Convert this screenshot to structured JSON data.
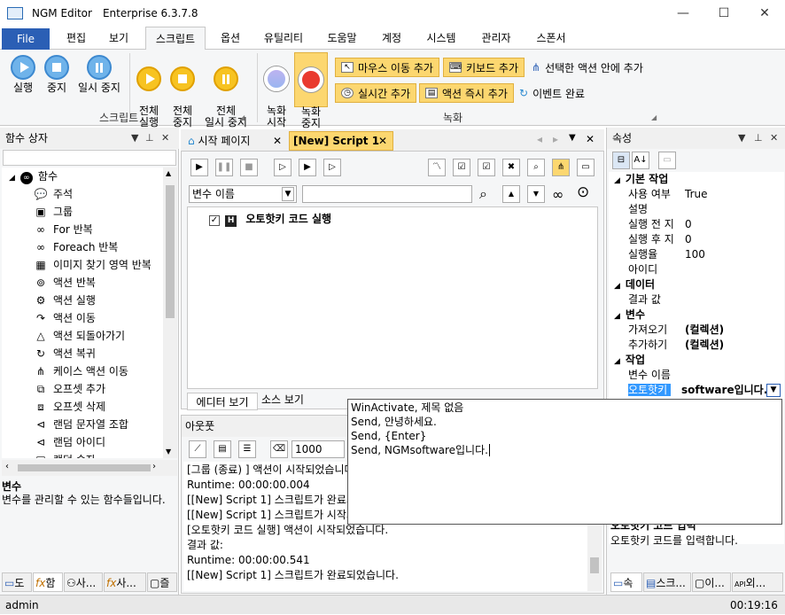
{
  "window": {
    "app_name": "NGM Editor",
    "edition": "Enterprise 6.3.7.8",
    "minimize": "—",
    "maximize": "☐",
    "close": "✕"
  },
  "menu": {
    "file": "File",
    "items": [
      "편집",
      "보기",
      "스크립트",
      "옵션",
      "유틸리티",
      "도움말",
      "계정",
      "시스템",
      "관리자",
      "스폰서"
    ]
  },
  "ribbon": {
    "script_group": "스크립트",
    "record_group": "녹화",
    "run": "실행",
    "stop": "중지",
    "pause": "일시 중지",
    "run_all": "전체\n실행",
    "stop_all": "전체\n중지",
    "pause_all": "전체\n일시 중지",
    "rec_start": "녹화\n시작",
    "rec_stop": "녹화\n중지",
    "add_mouse": "마우스 이동 추가",
    "add_keyboard": "키보드 추가",
    "add_in_selected": "선택한 액션 안에 추가",
    "add_realtime": "실시간 추가",
    "add_instant": "액션 즉시 추가",
    "event_done": "이벤트 완료"
  },
  "left_panel": {
    "title": "함수 상자",
    "root": "함수",
    "items": [
      {
        "label": "주석",
        "icon": "comment-icon",
        "glyph": "💬"
      },
      {
        "label": "그룹",
        "icon": "group-icon",
        "glyph": "▣"
      },
      {
        "label": "For 반복",
        "icon": "loop-icon",
        "glyph": "∞"
      },
      {
        "label": "Foreach 반복",
        "icon": "foreach-icon",
        "glyph": "∞"
      },
      {
        "label": "이미지 찾기 영역 반복",
        "icon": "image-search-icon",
        "glyph": "▦"
      },
      {
        "label": "액션 반복",
        "icon": "repeat-icon",
        "glyph": "⊚"
      },
      {
        "label": "액션 실행",
        "icon": "action-run-icon",
        "glyph": "⚙"
      },
      {
        "label": "액션 이동",
        "icon": "action-move-icon",
        "glyph": "↷"
      },
      {
        "label": "액션 되돌아가기",
        "icon": "action-back-icon",
        "glyph": "△"
      },
      {
        "label": "액션 복귀",
        "icon": "action-return-icon",
        "glyph": "↻"
      },
      {
        "label": "케이스 액션 이동",
        "icon": "case-move-icon",
        "glyph": "⋔"
      },
      {
        "label": "오프셋 추가",
        "icon": "offset-add-icon",
        "glyph": "⧉"
      },
      {
        "label": "오프셋 삭제",
        "icon": "offset-delete-icon",
        "glyph": "⧈"
      },
      {
        "label": "랜덤 문자열 조합",
        "icon": "random-string-icon",
        "glyph": "⊲"
      },
      {
        "label": "랜덤 아이디",
        "icon": "random-id-icon",
        "glyph": "⊲"
      },
      {
        "label": "랜덤 숫자",
        "icon": "random-number-icon",
        "glyph": "▣"
      }
    ],
    "desc_title": "변수",
    "desc_text": "변수를 관리할 수 있는 함수들입니다.",
    "bottom_tabs": [
      "도",
      "함",
      "사...",
      "사...",
      "즐"
    ]
  },
  "doc_tabs": {
    "start": "시작 페이지",
    "script": "[New] Script 1"
  },
  "editor": {
    "var_select": "변수 이름",
    "node_label": "오토핫키 코드 실행",
    "view_tabs": [
      "에디터 보기",
      "소스 보기"
    ]
  },
  "output": {
    "title": "아웃풋",
    "count": "1000",
    "lines": [
      "[그룹 (종료) ] 액션이 시작되었습니다.",
      "Runtime: 00:00:00.004",
      "[[New] Script 1] 스크립트가 완료되었습니다.",
      "[[New] Script 1] 스크립트가 시작되었습니다.",
      "[오토핫키 코드 실행] 액션이 시작되었습니다.",
      "결과 값:",
      "Runtime: 00:00:00.541",
      "[[New] Script 1] 스크립트가 완료되었습니다."
    ]
  },
  "properties": {
    "title": "속성",
    "categories": {
      "basic": "기본 작업",
      "data": "데이터",
      "variable": "변수",
      "task": "작업"
    },
    "rows": {
      "use": {
        "k": "사용 여부",
        "v": "True"
      },
      "desc": {
        "k": "설명",
        "v": ""
      },
      "before": {
        "k": "실행 전 지",
        "v": "0"
      },
      "after": {
        "k": "실행 후 지",
        "v": "0"
      },
      "rate": {
        "k": "실행율",
        "v": "100"
      },
      "id": {
        "k": "아이디",
        "v": ""
      },
      "result": {
        "k": "결과 값",
        "v": ""
      },
      "get": {
        "k": "가져오기",
        "v": "(컬렉션)"
      },
      "add": {
        "k": "추가하기",
        "v": "(컬렉션)"
      },
      "varname": {
        "k": "변수 이름",
        "v": ""
      },
      "ahk": {
        "k": "오토핫키",
        "v": "software입니다."
      }
    },
    "desc_title": "오토핫키 코드 입력",
    "desc_text": "오토핫키 코드를 입력합니다.",
    "bottom_tabs": [
      "속",
      "스크...",
      "이...",
      "외..."
    ]
  },
  "code_popup": {
    "lines": [
      "WinActivate, 제목 없음",
      "Send, 안녕하세요.",
      "Send, {Enter}",
      "Send, NGMsoftware입니다."
    ]
  },
  "status": {
    "user": "admin",
    "time": "00:19:16"
  },
  "colors": {
    "accent": "#2b5fb5",
    "ribbon_yellow": "#fcd770",
    "record_red": "#e93a2f",
    "play_blue": "#6fb3ea",
    "selection": "#3399ff"
  }
}
